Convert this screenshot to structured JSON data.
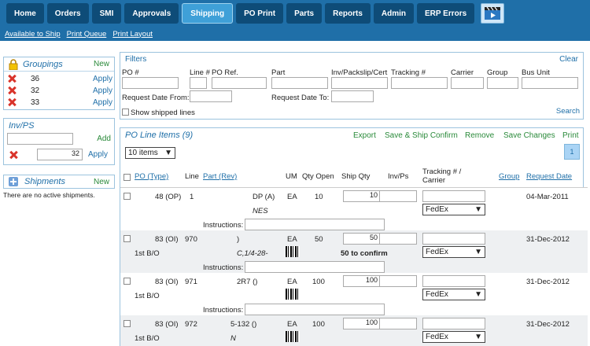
{
  "nav": {
    "items": [
      "Home",
      "Orders",
      "SMI",
      "Approvals",
      "Shipping",
      "PO Print",
      "Parts",
      "Reports",
      "Admin",
      "ERP Errors"
    ],
    "active_index": 4,
    "sub": [
      "Available to Ship",
      "Print Queue",
      "Print Layout"
    ]
  },
  "groupings": {
    "title": "Groupings",
    "new_label": "New",
    "items": [
      {
        "label": "36",
        "apply": "Apply"
      },
      {
        "label": "32",
        "apply": "Apply"
      },
      {
        "label": "33",
        "apply": "Apply"
      }
    ]
  },
  "invps": {
    "title": "Inv/PS",
    "add_label": "Add",
    "item_value": "32",
    "apply": "Apply"
  },
  "shipments": {
    "title": "Shipments",
    "new_label": "New",
    "empty_text": "There are no active shipments."
  },
  "filters": {
    "title": "Filters",
    "clear": "Clear",
    "labels": {
      "po": "PO #",
      "line": "Line #",
      "poref": "PO Ref.",
      "part": "Part",
      "inv": "Inv/Packslip/Cert",
      "tracking": "Tracking #",
      "carrier": "Carrier",
      "group": "Group",
      "bus": "Bus Unit"
    },
    "req_from": "Request Date From:",
    "req_to": "Request Date To:",
    "show_shipped": "Show shipped lines",
    "search": "Search"
  },
  "poline": {
    "title": "PO Line Items (9)",
    "actions": [
      "Export",
      "Save & Ship Confirm",
      "Remove",
      "Save Changes",
      "Print"
    ],
    "page_size": "10 items",
    "page_num": "1",
    "headers": {
      "po": "PO (Type)",
      "line": "Line",
      "part": "Part (Rev)",
      "um": "UM",
      "qty_open": "Qty Open",
      "ship_qty": "Ship Qty",
      "invps": "Inv/Ps",
      "tracking": "Tracking # / Carrier",
      "group": "Group",
      "req_date": "Request Date"
    },
    "instructions_label": "Instructions:",
    "rows": [
      {
        "po": "48 (OP)",
        "line": "1",
        "part": "DP (A)",
        "part2": "NES",
        "um": "EA",
        "qty_open": "10",
        "ship_qty": "10",
        "carrier": "FedEx",
        "req_date": "04-Mar-2011",
        "sub": "",
        "confirm": ""
      },
      {
        "po": "83 (OI)",
        "line": "970",
        "part": ")",
        "part2": "C,1/4-28-",
        "um": "EA",
        "qty_open": "50",
        "ship_qty": "50",
        "carrier": "FedEx",
        "req_date": "31-Dec-2012",
        "sub": "1st B/O",
        "confirm": "50 to confirm"
      },
      {
        "po": "83 (OI)",
        "line": "971",
        "part": "2R7 ()",
        "part2": "",
        "um": "EA",
        "qty_open": "100",
        "ship_qty": "100",
        "carrier": "FedEx",
        "req_date": "31-Dec-2012",
        "sub": "1st B/O",
        "confirm": ""
      },
      {
        "po": "83 (OI)",
        "line": "972",
        "part": "5-132 ()",
        "part2": "N",
        "um": "EA",
        "qty_open": "100",
        "ship_qty": "100",
        "carrier": "FedEx",
        "req_date": "31-Dec-2012",
        "sub": "1st B/O",
        "confirm": ""
      }
    ]
  },
  "colors": {
    "brand": "#1f6fa8",
    "action": "#2a8a3a",
    "remove": "#d9342b"
  }
}
